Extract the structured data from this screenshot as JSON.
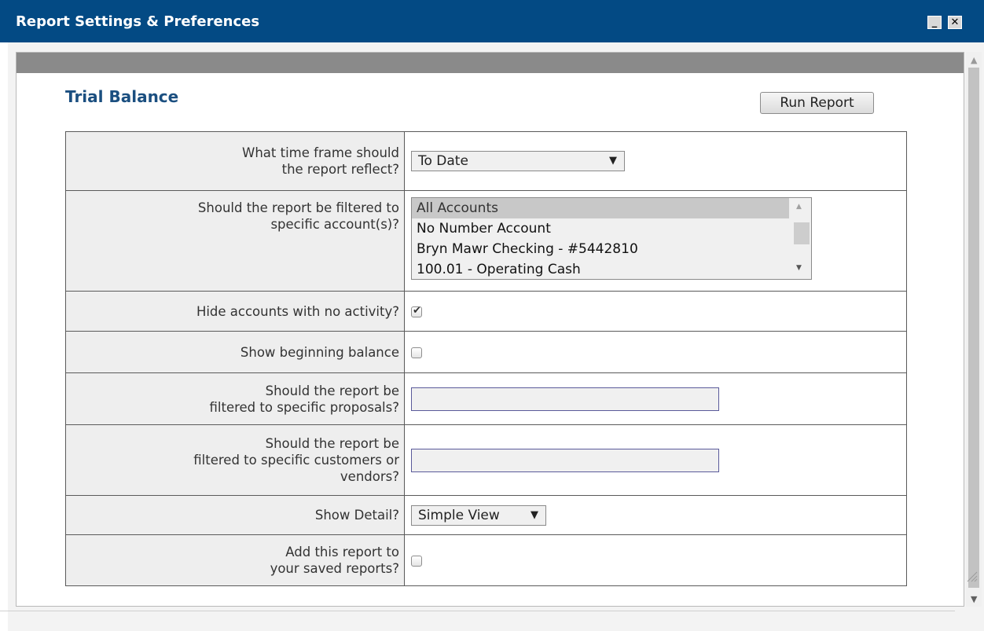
{
  "window": {
    "title": "Report Settings & Preferences",
    "min_label": "_",
    "close_label": "✕"
  },
  "report": {
    "title": "Trial Balance",
    "run_button": "Run Report"
  },
  "rows": {
    "timeframe": {
      "label_l1": "What time frame should",
      "label_l2": "the report reflect?",
      "value": "To Date",
      "caret": "▼"
    },
    "accounts": {
      "label_l1": "Should the report be filtered to",
      "label_l2": "specific account(s)?",
      "options": [
        "All Accounts",
        "No Number Account",
        "Bryn Mawr Checking - #5442810",
        "100.01 - Operating Cash"
      ],
      "selected": "All Accounts"
    },
    "hide_inactive": {
      "label": "Hide accounts with no activity?",
      "checked": true
    },
    "beginning_balance": {
      "label": "Show beginning balance",
      "checked": false
    },
    "proposals": {
      "label_l1": "Should the report be",
      "label_l2": "filtered to specific proposals?",
      "value": ""
    },
    "customers": {
      "label_l1": "Should the report be",
      "label_l2": "filtered to specific customers or",
      "label_l3": "vendors?",
      "value": ""
    },
    "detail": {
      "label": "Show Detail?",
      "value": "Simple View",
      "caret": "▼"
    },
    "save_report": {
      "label_l1": "Add this report to",
      "label_l2": "your saved reports?",
      "checked": false
    }
  },
  "icons": {
    "check": "check-icon",
    "up": "chevron-up-icon",
    "down": "chevron-down-icon",
    "grip": "resize-grip-icon"
  },
  "colors": {
    "titlebar": "#034a84",
    "heading": "#1b4f80",
    "graybar": "#8a8a8a"
  }
}
